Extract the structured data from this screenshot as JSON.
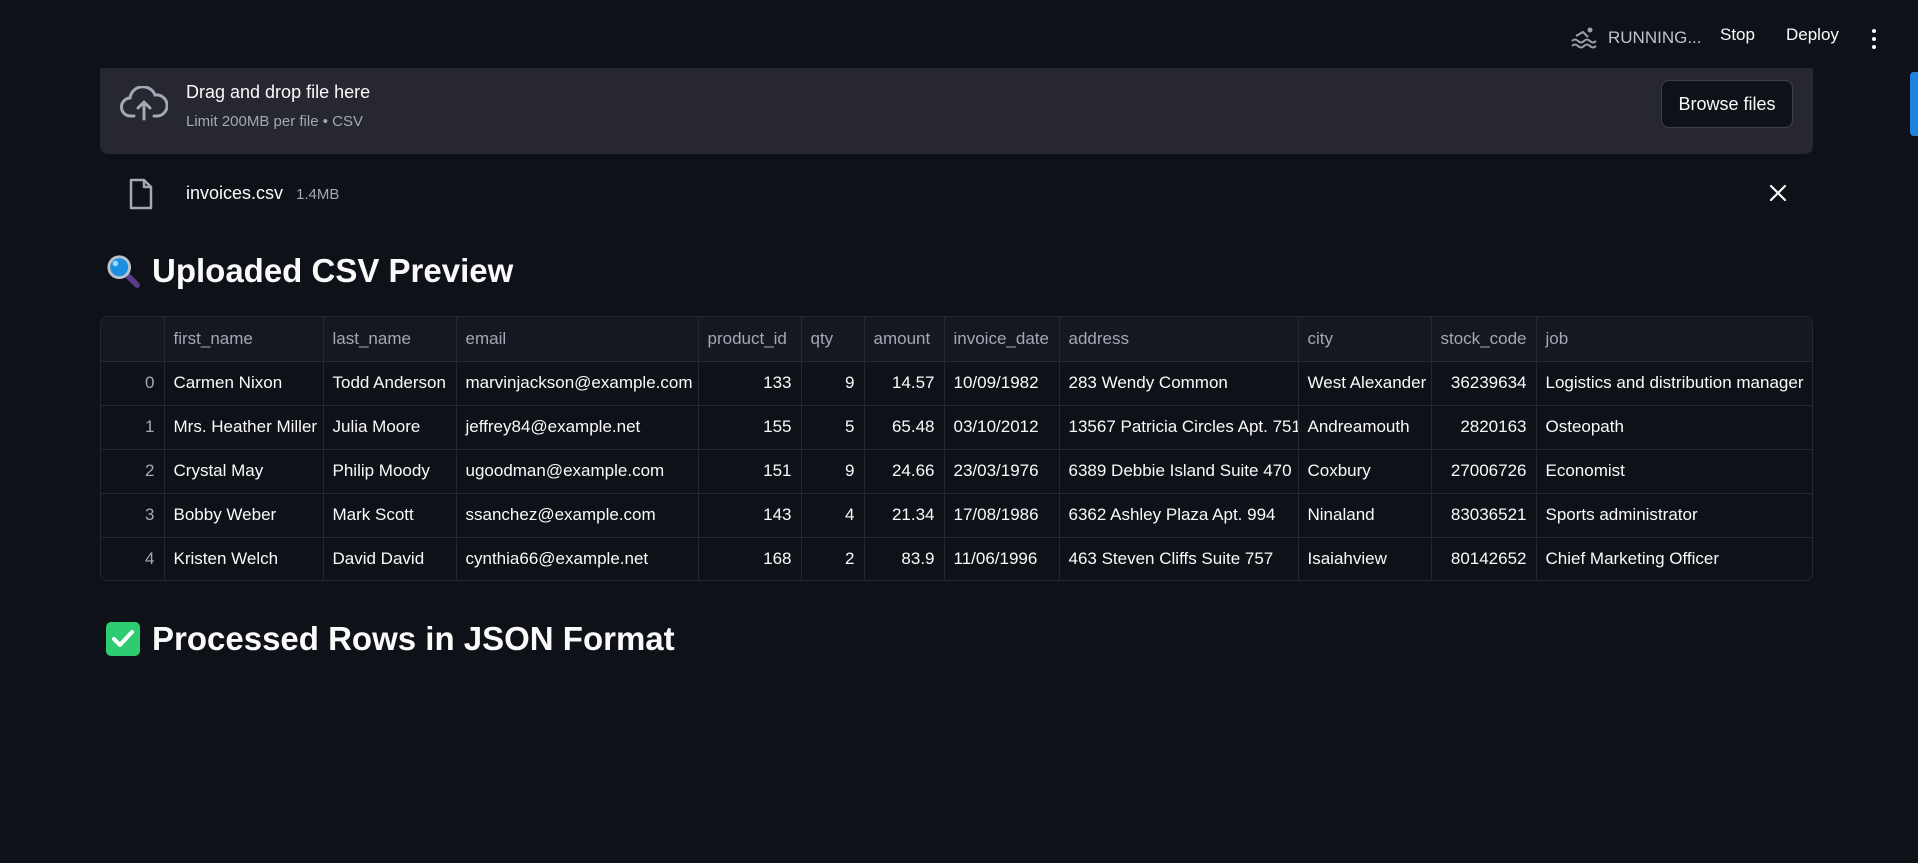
{
  "header": {
    "status_text": "RUNNING...",
    "stop_label": "Stop",
    "deploy_label": "Deploy"
  },
  "uploader": {
    "title": "Drag and drop file here",
    "subtitle": "Limit 200MB per file • CSV",
    "browse_label": "Browse files"
  },
  "file": {
    "name": "invoices.csv",
    "size": "1.4MB"
  },
  "sections": {
    "preview_title": "Uploaded CSV Preview",
    "processed_title": "Processed Rows in JSON Format"
  },
  "table": {
    "columns": [
      "",
      "first_name",
      "last_name",
      "email",
      "product_id",
      "qty",
      "amount",
      "invoice_date",
      "address",
      "city",
      "stock_code",
      "job"
    ],
    "rows": [
      [
        "0",
        "Carmen Nixon",
        "Todd Anderson",
        "marvinjackson@example.com",
        "133",
        "9",
        "14.57",
        "10/09/1982",
        "283 Wendy Common",
        "West Alexander",
        "36239634",
        "Logistics and distribution manager"
      ],
      [
        "1",
        "Mrs. Heather Miller",
        "Julia Moore",
        "jeffrey84@example.net",
        "155",
        "5",
        "65.48",
        "03/10/2012",
        "13567 Patricia Circles Apt. 751",
        "Andreamouth",
        "2820163",
        "Osteopath"
      ],
      [
        "2",
        "Crystal May",
        "Philip Moody",
        "ugoodman@example.com",
        "151",
        "9",
        "24.66",
        "23/03/1976",
        "6389 Debbie Island Suite 470",
        "Coxbury",
        "27006726",
        "Economist"
      ],
      [
        "3",
        "Bobby Weber",
        "Mark Scott",
        "ssanchez@example.com",
        "143",
        "4",
        "21.34",
        "17/08/1986",
        "6362 Ashley Plaza Apt. 994",
        "Ninaland",
        "83036521",
        "Sports administrator"
      ],
      [
        "4",
        "Kristen Welch",
        "David David",
        "cynthia66@example.net",
        "168",
        "2",
        "83.9",
        "11/06/1996",
        "463 Steven Cliffs Suite 757",
        "Isaiahview",
        "80142652",
        "Chief Marketing Officer"
      ]
    ]
  },
  "colors": {
    "background": "#0e1117",
    "panel": "#262730",
    "accent": "#1c83e1",
    "check_green": "#2ecc71"
  }
}
